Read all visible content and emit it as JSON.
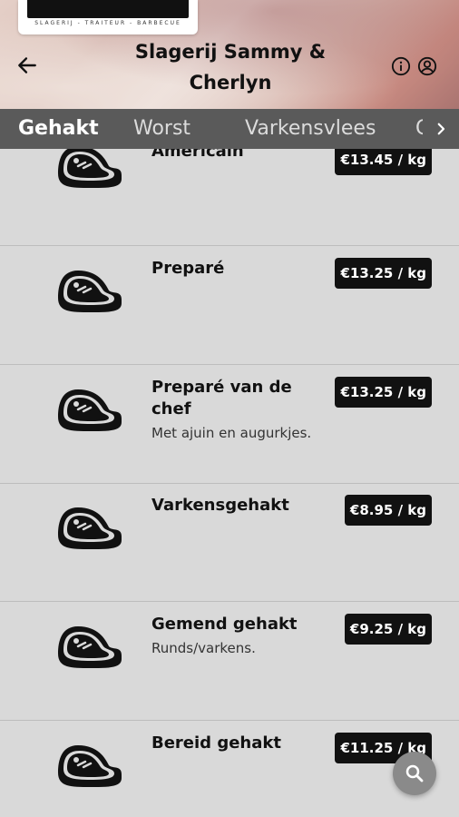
{
  "header": {
    "title": "Slagerij Sammy & Cherlyn",
    "logo_tagline": "SLAGERIJ - TRAITEUR - BARBECUE",
    "icons": [
      "back-arrow-icon",
      "info-icon",
      "account-icon"
    ]
  },
  "tabs": [
    {
      "label": "Gehakt",
      "active": true
    },
    {
      "label": "Worst",
      "active": false
    },
    {
      "label": "Varkensvlees",
      "active": false
    },
    {
      "label": "G",
      "active": false
    }
  ],
  "products": [
    {
      "name": "Americain",
      "description": "",
      "price": "€13.45 / kg",
      "icon": "meat-steak-icon"
    },
    {
      "name": "Preparé",
      "description": "",
      "price": "€13.25 / kg",
      "icon": "meat-steak-icon"
    },
    {
      "name": "Preparé van de chef",
      "description": "Met ajuin en augurkjes.",
      "price": "€13.25 / kg",
      "icon": "meat-steak-icon"
    },
    {
      "name": "Varkensgehakt",
      "description": "",
      "price": "€8.95 / kg",
      "icon": "meat-steak-icon"
    },
    {
      "name": "Gemend gehakt",
      "description": "Runds/varkens.",
      "price": "€9.25 / kg",
      "icon": "meat-steak-icon"
    },
    {
      "name": "Bereid gehakt",
      "description": "",
      "price": "€11.25 / kg",
      "icon": "meat-steak-icon"
    }
  ],
  "fab": {
    "icon": "search-icon"
  },
  "colors": {
    "tab_bar": "#5a5a5a",
    "list_bg": "#d9d9d9",
    "price_badge": "#111111"
  }
}
